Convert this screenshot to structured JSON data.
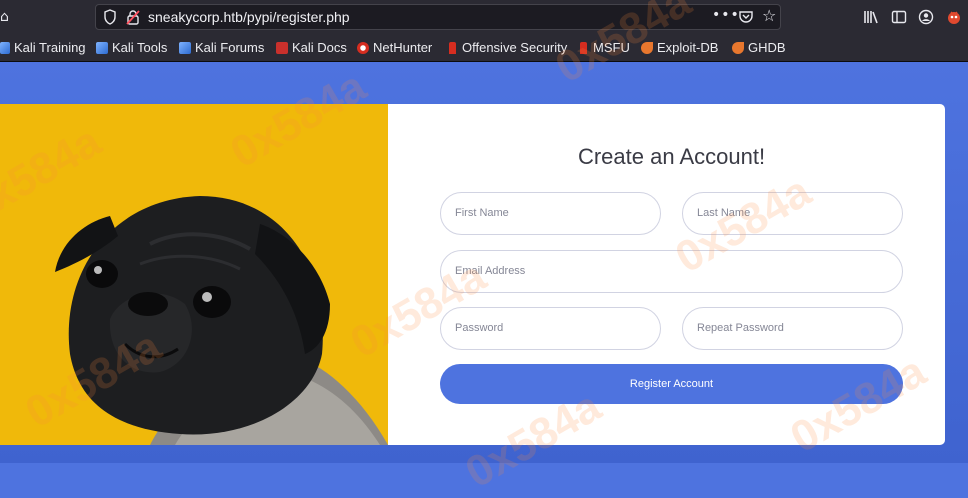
{
  "browser": {
    "url": "sneakycorp.htb/pypi/register.php",
    "page_actions_label": "•••"
  },
  "bookmarks": [
    {
      "label": "Kali Training"
    },
    {
      "label": "Kali Tools"
    },
    {
      "label": "Kali Forums"
    },
    {
      "label": "Kali Docs"
    },
    {
      "label": "NetHunter"
    },
    {
      "label": "Offensive Security"
    },
    {
      "label": "MSFU"
    },
    {
      "label": "Exploit-DB"
    },
    {
      "label": "GHDB"
    }
  ],
  "form": {
    "title": "Create an Account!",
    "first_name_placeholder": "First Name",
    "last_name_placeholder": "Last Name",
    "email_placeholder": "Email Address",
    "password_placeholder": "Password",
    "repeat_password_placeholder": "Repeat Password",
    "register_label": "Register Account"
  },
  "watermark": {
    "text": "0x584a"
  },
  "colors": {
    "primary": "#4e73df",
    "dog_panel": "#f0b90a"
  }
}
